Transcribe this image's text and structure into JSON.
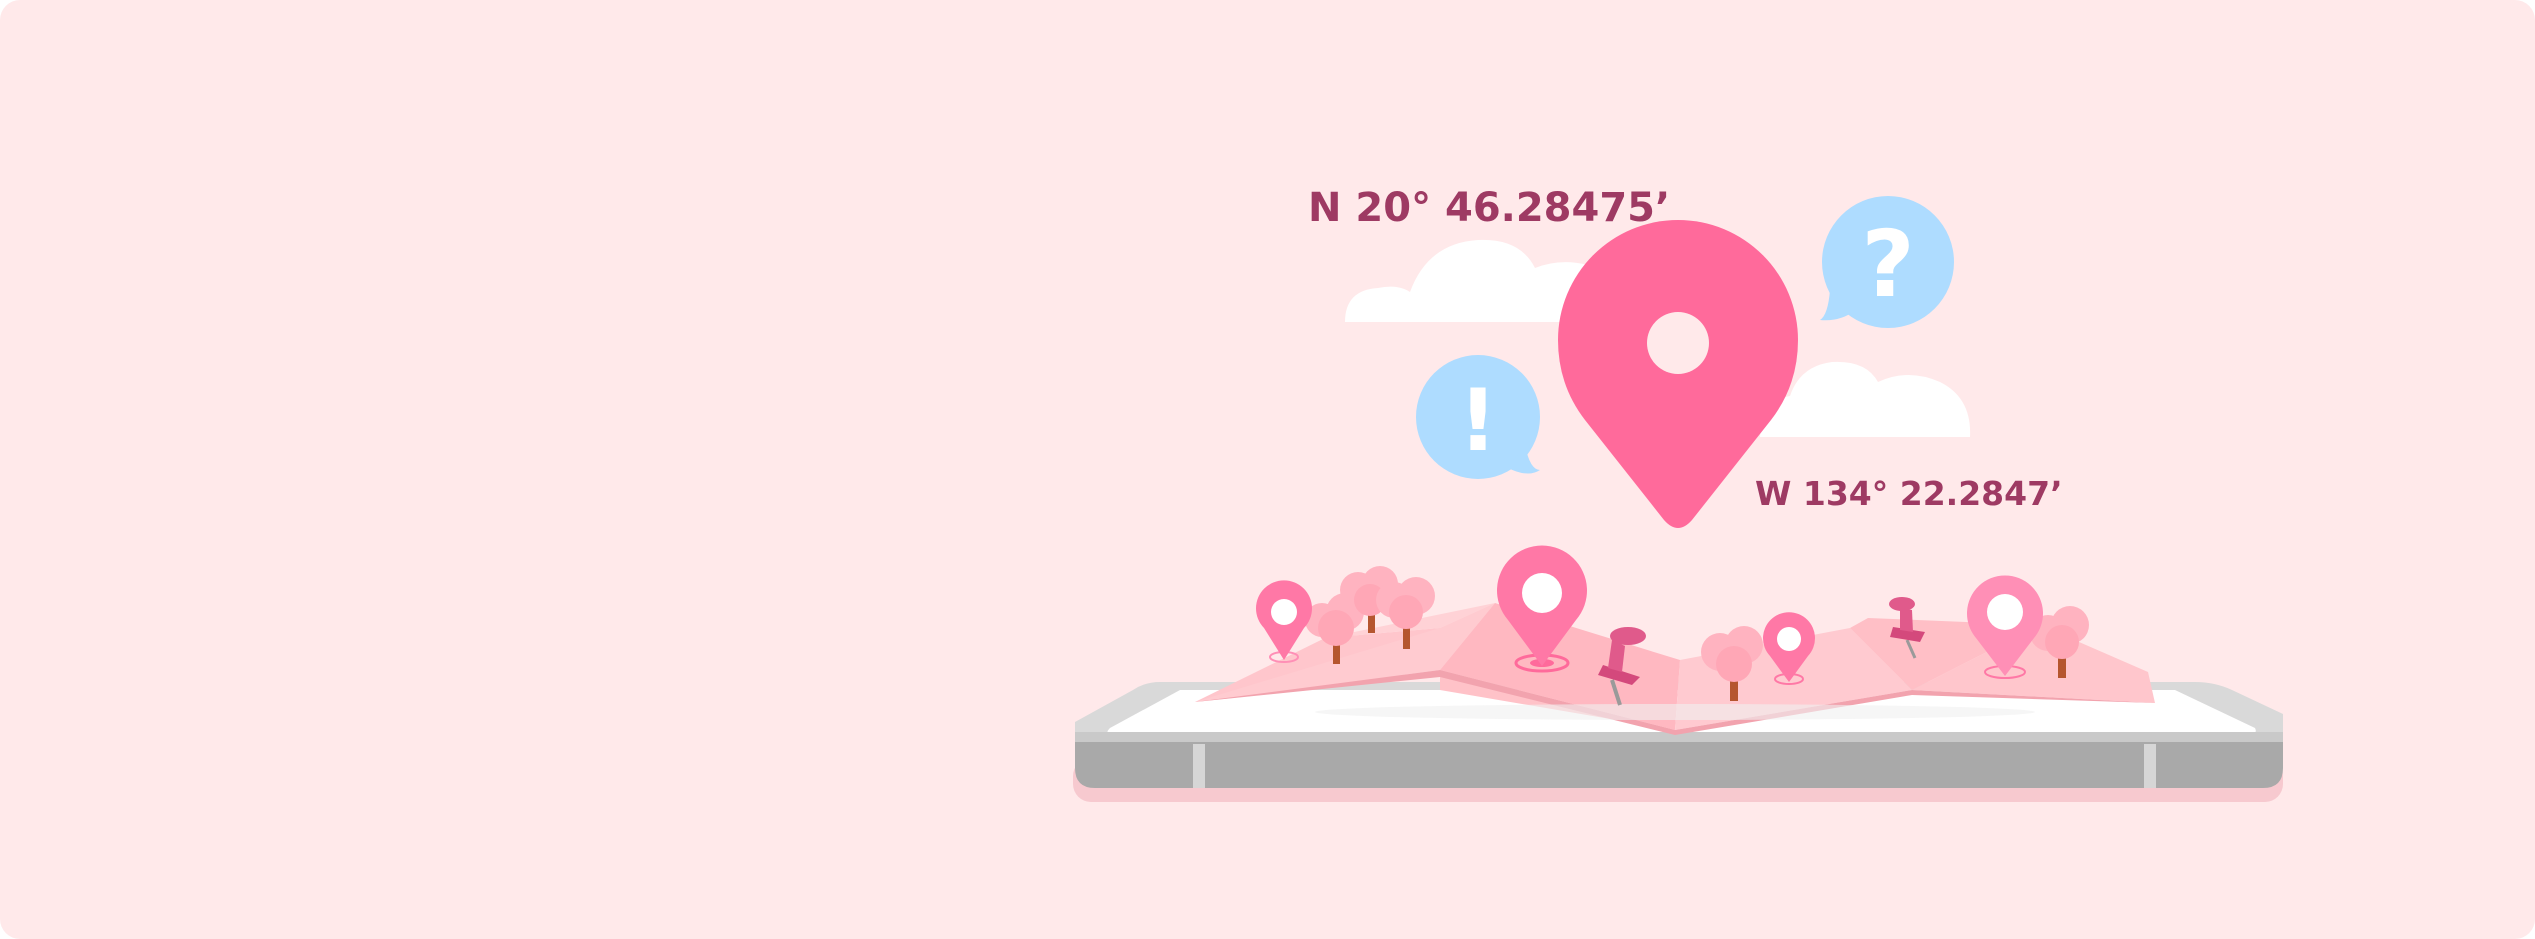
{
  "coordinates": {
    "latitude": "N 20° 46.28475’",
    "longitude": "W 134° 22.2847’"
  },
  "bubbles": {
    "exclamation": "!",
    "question": "?"
  },
  "colors": {
    "background": "#ffe9ea",
    "pin_main": "#ff6a9b",
    "pin_light": "#ff8fb6",
    "map_fold": "#ffc2c8",
    "bubble": "#aedcff",
    "text": "#9e3a63",
    "phone_body": "#a9a9a9"
  },
  "icons": [
    "location-pin-icon",
    "exclamation-icon",
    "question-icon",
    "push-pin-icon",
    "tree-icon",
    "cloud-icon",
    "smartphone-icon"
  ]
}
